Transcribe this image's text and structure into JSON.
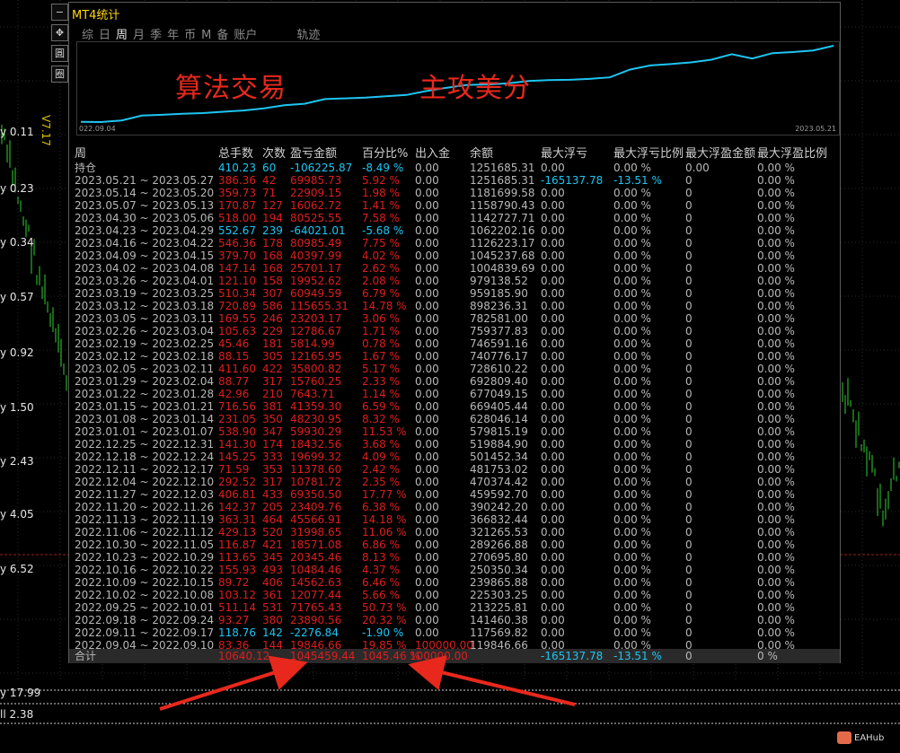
{
  "window": {
    "title": "MT4统计",
    "version_label": "V7.17"
  },
  "tool_buttons": [
    "✥",
    "圓",
    "圈"
  ],
  "tabs": [
    {
      "label": "综",
      "active": false
    },
    {
      "label": "日",
      "active": false
    },
    {
      "label": "周",
      "active": true
    },
    {
      "label": "月",
      "active": false
    },
    {
      "label": "季",
      "active": false
    },
    {
      "label": "年",
      "active": false
    },
    {
      "label": "币",
      "active": false
    },
    {
      "label": "M",
      "active": false
    },
    {
      "label": "备",
      "active": false
    },
    {
      "label": "账户",
      "active": false
    },
    {
      "label": "轨迹",
      "active": false,
      "gap": true
    }
  ],
  "equity_chart": {
    "start_label": "022.09.04",
    "end_label": "2023.05.21",
    "line_color": "#1ec5f2",
    "balance_points": [
      119846.66,
      117569.82,
      141460.38,
      213225.81,
      225303.25,
      239865.88,
      250350.34,
      270695.8,
      289266.88,
      321265.53,
      366832.44,
      390242.2,
      459592.7,
      470374.42,
      481753.02,
      501452.34,
      519884.9,
      579815.19,
      628046.14,
      669405.44,
      677049.15,
      692809.4,
      728610.22,
      740776.17,
      746591.16,
      759377.83,
      782581.0,
      898236.31,
      959185.9,
      979138.52,
      1004839.69,
      1045237.68,
      1126223.17,
      1062202.16,
      1142727.71,
      1158790.43,
      1181699.58,
      1251685.31
    ]
  },
  "overlay_texts": {
    "left": "算法交易",
    "right": "主攻美分"
  },
  "table": {
    "headers": [
      "周",
      "总手数",
      "次数",
      "盈亏金额",
      "百分比%",
      "出入金",
      "余额",
      "最大浮亏",
      "最大浮亏比例",
      "最大浮盈金额",
      "最大浮盈比例"
    ],
    "rows": [
      {
        "period": "持仓",
        "lots": "410.23",
        "count": "60",
        "pnl": "-106225.87",
        "pct": "-8.49 %",
        "io": "0.00",
        "balance": "1251685.31",
        "maxdd": "0.00",
        "maxdd_pct": "0.00 %",
        "maxfp": "0.00",
        "maxfp_pct": "0.00 %",
        "tone": "blue"
      },
      {
        "period": "2023.05.21 ~ 2023.05.27",
        "lots": "386.36",
        "count": "42",
        "pnl": "69985.73",
        "pct": "5.92 %",
        "io": "0.00",
        "balance": "1251685.31",
        "maxdd": "-165137.78",
        "maxdd_pct": "-13.51 %",
        "maxfp": "0",
        "maxfp_pct": "0.00 %",
        "tone": "red",
        "dd_tone": "blue"
      },
      {
        "period": "2023.05.14 ~ 2023.05.20",
        "lots": "359.73",
        "count": "71",
        "pnl": "22909.15",
        "pct": "1.98 %",
        "io": "0.00",
        "balance": "1181699.58",
        "maxdd": "0.00",
        "maxdd_pct": "0.00 %",
        "maxfp": "0",
        "maxfp_pct": "0.00 %",
        "tone": "red"
      },
      {
        "period": "2023.05.07 ~ 2023.05.13",
        "lots": "170.87",
        "count": "127",
        "pnl": "16062.72",
        "pct": "1.41 %",
        "io": "0.00",
        "balance": "1158790.43",
        "maxdd": "0.00",
        "maxdd_pct": "0.00 %",
        "maxfp": "0",
        "maxfp_pct": "0.00 %",
        "tone": "red"
      },
      {
        "period": "2023.04.30 ~ 2023.05.06",
        "lots": "518.00",
        "count": "194",
        "pnl": "80525.55",
        "pct": "7.58 %",
        "io": "0.00",
        "balance": "1142727.71",
        "maxdd": "0.00",
        "maxdd_pct": "0.00 %",
        "maxfp": "0",
        "maxfp_pct": "0.00 %",
        "tone": "red"
      },
      {
        "period": "2023.04.23 ~ 2023.04.29",
        "lots": "552.67",
        "count": "239",
        "pnl": "-64021.01",
        "pct": "-5.68 %",
        "io": "0.00",
        "balance": "1062202.16",
        "maxdd": "0.00",
        "maxdd_pct": "0.00 %",
        "maxfp": "0",
        "maxfp_pct": "0.00 %",
        "tone": "blue"
      },
      {
        "period": "2023.04.16 ~ 2023.04.22",
        "lots": "546.36",
        "count": "178",
        "pnl": "80985.49",
        "pct": "7.75 %",
        "io": "0.00",
        "balance": "1126223.17",
        "maxdd": "0.00",
        "maxdd_pct": "0.00 %",
        "maxfp": "0",
        "maxfp_pct": "0.00 %",
        "tone": "red"
      },
      {
        "period": "2023.04.09 ~ 2023.04.15",
        "lots": "379.70",
        "count": "168",
        "pnl": "40397.99",
        "pct": "4.02 %",
        "io": "0.00",
        "balance": "1045237.68",
        "maxdd": "0.00",
        "maxdd_pct": "0.00 %",
        "maxfp": "0",
        "maxfp_pct": "0.00 %",
        "tone": "red"
      },
      {
        "period": "2023.04.02 ~ 2023.04.08",
        "lots": "147.14",
        "count": "168",
        "pnl": "25701.17",
        "pct": "2.62 %",
        "io": "0.00",
        "balance": "1004839.69",
        "maxdd": "0.00",
        "maxdd_pct": "0.00 %",
        "maxfp": "0",
        "maxfp_pct": "0.00 %",
        "tone": "red"
      },
      {
        "period": "2023.03.26 ~ 2023.04.01",
        "lots": "121.10",
        "count": "158",
        "pnl": "19952.62",
        "pct": "2.08 %",
        "io": "0.00",
        "balance": "979138.52",
        "maxdd": "0.00",
        "maxdd_pct": "0.00 %",
        "maxfp": "0",
        "maxfp_pct": "0.00 %",
        "tone": "red"
      },
      {
        "period": "2023.03.19 ~ 2023.03.25",
        "lots": "510.34",
        "count": "307",
        "pnl": "60949.59",
        "pct": "6.79 %",
        "io": "0.00",
        "balance": "959185.90",
        "maxdd": "0.00",
        "maxdd_pct": "0.00 %",
        "maxfp": "0",
        "maxfp_pct": "0.00 %",
        "tone": "red"
      },
      {
        "period": "2023.03.12 ~ 2023.03.18",
        "lots": "720.89",
        "count": "586",
        "pnl": "115655.31",
        "pct": "14.78 %",
        "io": "0.00",
        "balance": "898236.31",
        "maxdd": "0.00",
        "maxdd_pct": "0.00 %",
        "maxfp": "0",
        "maxfp_pct": "0.00 %",
        "tone": "red"
      },
      {
        "period": "2023.03.05 ~ 2023.03.11",
        "lots": "169.55",
        "count": "246",
        "pnl": "23203.17",
        "pct": "3.06 %",
        "io": "0.00",
        "balance": "782581.00",
        "maxdd": "0.00",
        "maxdd_pct": "0.00 %",
        "maxfp": "0",
        "maxfp_pct": "0.00 %",
        "tone": "red"
      },
      {
        "period": "2023.02.26 ~ 2023.03.04",
        "lots": "105.63",
        "count": "229",
        "pnl": "12786.67",
        "pct": "1.71 %",
        "io": "0.00",
        "balance": "759377.83",
        "maxdd": "0.00",
        "maxdd_pct": "0.00 %",
        "maxfp": "0",
        "maxfp_pct": "0.00 %",
        "tone": "red"
      },
      {
        "period": "2023.02.19 ~ 2023.02.25",
        "lots": "45.46",
        "count": "181",
        "pnl": "5814.99",
        "pct": "0.78 %",
        "io": "0.00",
        "balance": "746591.16",
        "maxdd": "0.00",
        "maxdd_pct": "0.00 %",
        "maxfp": "0",
        "maxfp_pct": "0.00 %",
        "tone": "red"
      },
      {
        "period": "2023.02.12 ~ 2023.02.18",
        "lots": "88.15",
        "count": "305",
        "pnl": "12165.95",
        "pct": "1.67 %",
        "io": "0.00",
        "balance": "740776.17",
        "maxdd": "0.00",
        "maxdd_pct": "0.00 %",
        "maxfp": "0",
        "maxfp_pct": "0.00 %",
        "tone": "red"
      },
      {
        "period": "2023.02.05 ~ 2023.02.11",
        "lots": "411.60",
        "count": "422",
        "pnl": "35800.82",
        "pct": "5.17 %",
        "io": "0.00",
        "balance": "728610.22",
        "maxdd": "0.00",
        "maxdd_pct": "0.00 %",
        "maxfp": "0",
        "maxfp_pct": "0.00 %",
        "tone": "red"
      },
      {
        "period": "2023.01.29 ~ 2023.02.04",
        "lots": "88.77",
        "count": "317",
        "pnl": "15760.25",
        "pct": "2.33 %",
        "io": "0.00",
        "balance": "692809.40",
        "maxdd": "0.00",
        "maxdd_pct": "0.00 %",
        "maxfp": "0",
        "maxfp_pct": "0.00 %",
        "tone": "red"
      },
      {
        "period": "2023.01.22 ~ 2023.01.28",
        "lots": "42.96",
        "count": "210",
        "pnl": "7643.71",
        "pct": "1.14 %",
        "io": "0.00",
        "balance": "677049.15",
        "maxdd": "0.00",
        "maxdd_pct": "0.00 %",
        "maxfp": "0",
        "maxfp_pct": "0.00 %",
        "tone": "red"
      },
      {
        "period": "2023.01.15 ~ 2023.01.21",
        "lots": "716.56",
        "count": "381",
        "pnl": "41359.30",
        "pct": "6.59 %",
        "io": "0.00",
        "balance": "669405.44",
        "maxdd": "0.00",
        "maxdd_pct": "0.00 %",
        "maxfp": "0",
        "maxfp_pct": "0.00 %",
        "tone": "red"
      },
      {
        "period": "2023.01.08 ~ 2023.01.14",
        "lots": "231.05",
        "count": "350",
        "pnl": "48230.95",
        "pct": "8.32 %",
        "io": "0.00",
        "balance": "628046.14",
        "maxdd": "0.00",
        "maxdd_pct": "0.00 %",
        "maxfp": "0",
        "maxfp_pct": "0.00 %",
        "tone": "red"
      },
      {
        "period": "2023.01.01 ~ 2023.01.07",
        "lots": "538.90",
        "count": "347",
        "pnl": "59930.29",
        "pct": "11.53 %",
        "io": "0.00",
        "balance": "579815.19",
        "maxdd": "0.00",
        "maxdd_pct": "0.00 %",
        "maxfp": "0",
        "maxfp_pct": "0.00 %",
        "tone": "red"
      },
      {
        "period": "2022.12.25 ~ 2022.12.31",
        "lots": "141.30",
        "count": "174",
        "pnl": "18432.56",
        "pct": "3.68 %",
        "io": "0.00",
        "balance": "519884.90",
        "maxdd": "0.00",
        "maxdd_pct": "0.00 %",
        "maxfp": "0",
        "maxfp_pct": "0.00 %",
        "tone": "red"
      },
      {
        "period": "2022.12.18 ~ 2022.12.24",
        "lots": "145.25",
        "count": "333",
        "pnl": "19699.32",
        "pct": "4.09 %",
        "io": "0.00",
        "balance": "501452.34",
        "maxdd": "0.00",
        "maxdd_pct": "0.00 %",
        "maxfp": "0",
        "maxfp_pct": "0.00 %",
        "tone": "red"
      },
      {
        "period": "2022.12.11 ~ 2022.12.17",
        "lots": "71.59",
        "count": "353",
        "pnl": "11378.60",
        "pct": "2.42 %",
        "io": "0.00",
        "balance": "481753.02",
        "maxdd": "0.00",
        "maxdd_pct": "0.00 %",
        "maxfp": "0",
        "maxfp_pct": "0.00 %",
        "tone": "red"
      },
      {
        "period": "2022.12.04 ~ 2022.12.10",
        "lots": "292.52",
        "count": "317",
        "pnl": "10781.72",
        "pct": "2.35 %",
        "io": "0.00",
        "balance": "470374.42",
        "maxdd": "0.00",
        "maxdd_pct": "0.00 %",
        "maxfp": "0",
        "maxfp_pct": "0.00 %",
        "tone": "red"
      },
      {
        "period": "2022.11.27 ~ 2022.12.03",
        "lots": "406.81",
        "count": "433",
        "pnl": "69350.50",
        "pct": "17.77 %",
        "io": "0.00",
        "balance": "459592.70",
        "maxdd": "0.00",
        "maxdd_pct": "0.00 %",
        "maxfp": "0",
        "maxfp_pct": "0.00 %",
        "tone": "red"
      },
      {
        "period": "2022.11.20 ~ 2022.11.26",
        "lots": "142.37",
        "count": "205",
        "pnl": "23409.76",
        "pct": "6.38 %",
        "io": "0.00",
        "balance": "390242.20",
        "maxdd": "0.00",
        "maxdd_pct": "0.00 %",
        "maxfp": "0",
        "maxfp_pct": "0.00 %",
        "tone": "red"
      },
      {
        "period": "2022.11.13 ~ 2022.11.19",
        "lots": "363.31",
        "count": "464",
        "pnl": "45566.91",
        "pct": "14.18 %",
        "io": "0.00",
        "balance": "366832.44",
        "maxdd": "0.00",
        "maxdd_pct": "0.00 %",
        "maxfp": "0",
        "maxfp_pct": "0.00 %",
        "tone": "red"
      },
      {
        "period": "2022.11.06 ~ 2022.11.12",
        "lots": "429.13",
        "count": "520",
        "pnl": "31998.65",
        "pct": "11.06 %",
        "io": "0.00",
        "balance": "321265.53",
        "maxdd": "0.00",
        "maxdd_pct": "0.00 %",
        "maxfp": "0",
        "maxfp_pct": "0.00 %",
        "tone": "red"
      },
      {
        "period": "2022.10.30 ~ 2022.11.05",
        "lots": "116.87",
        "count": "421",
        "pnl": "18571.08",
        "pct": "6.86 %",
        "io": "0.00",
        "balance": "289266.88",
        "maxdd": "0.00",
        "maxdd_pct": "0.00 %",
        "maxfp": "0",
        "maxfp_pct": "0.00 %",
        "tone": "red"
      },
      {
        "period": "2022.10.23 ~ 2022.10.29",
        "lots": "113.65",
        "count": "345",
        "pnl": "20345.46",
        "pct": "8.13 %",
        "io": "0.00",
        "balance": "270695.80",
        "maxdd": "0.00",
        "maxdd_pct": "0.00 %",
        "maxfp": "0",
        "maxfp_pct": "0.00 %",
        "tone": "red"
      },
      {
        "period": "2022.10.16 ~ 2022.10.22",
        "lots": "155.93",
        "count": "493",
        "pnl": "10484.46",
        "pct": "4.37 %",
        "io": "0.00",
        "balance": "250350.34",
        "maxdd": "0.00",
        "maxdd_pct": "0.00 %",
        "maxfp": "0",
        "maxfp_pct": "0.00 %",
        "tone": "red"
      },
      {
        "period": "2022.10.09 ~ 2022.10.15",
        "lots": "89.72",
        "count": "406",
        "pnl": "14562.63",
        "pct": "6.46 %",
        "io": "0.00",
        "balance": "239865.88",
        "maxdd": "0.00",
        "maxdd_pct": "0.00 %",
        "maxfp": "0",
        "maxfp_pct": "0.00 %",
        "tone": "red"
      },
      {
        "period": "2022.10.02 ~ 2022.10.08",
        "lots": "103.12",
        "count": "361",
        "pnl": "12077.44",
        "pct": "5.66 %",
        "io": "0.00",
        "balance": "225303.25",
        "maxdd": "0.00",
        "maxdd_pct": "0.00 %",
        "maxfp": "0",
        "maxfp_pct": "0.00 %",
        "tone": "red"
      },
      {
        "period": "2022.09.25 ~ 2022.10.01",
        "lots": "511.14",
        "count": "531",
        "pnl": "71765.43",
        "pct": "50.73 %",
        "io": "0.00",
        "balance": "213225.81",
        "maxdd": "0.00",
        "maxdd_pct": "0.00 %",
        "maxfp": "0",
        "maxfp_pct": "0.00 %",
        "tone": "red"
      },
      {
        "period": "2022.09.18 ~ 2022.09.24",
        "lots": "93.27",
        "count": "380",
        "pnl": "23890.56",
        "pct": "20.32 %",
        "io": "0.00",
        "balance": "141460.38",
        "maxdd": "0.00",
        "maxdd_pct": "0.00 %",
        "maxfp": "0",
        "maxfp_pct": "0.00 %",
        "tone": "red"
      },
      {
        "period": "2022.09.11 ~ 2022.09.17",
        "lots": "118.76",
        "count": "142",
        "pnl": "-2276.84",
        "pct": "-1.90 %",
        "io": "0.00",
        "balance": "117569.82",
        "maxdd": "0.00",
        "maxdd_pct": "0.00 %",
        "maxfp": "0",
        "maxfp_pct": "0.00 %",
        "tone": "blue"
      },
      {
        "period": "2022.09.04 ~ 2022.09.10",
        "lots": "83.36",
        "count": "144",
        "pnl": "19846.66",
        "pct": "19.85 %",
        "io": "100000.00",
        "balance": "119846.66",
        "maxdd": "0.00",
        "maxdd_pct": "0.00 %",
        "maxfp": "0",
        "maxfp_pct": "0.00 %",
        "tone": "red",
        "io_tone": "red"
      }
    ],
    "total": {
      "period": "合计",
      "lots": "10640.12",
      "count": "",
      "pnl": "1045459.44",
      "pct": "1045.46 %",
      "io": "100000.00",
      "balance": "",
      "maxdd": "-165137.78",
      "maxdd_pct": "-13.51 %",
      "maxfp": "0",
      "maxfp_pct": "0 %"
    }
  },
  "price_axis_labels": [
    "y 0.11",
    "y 0.23",
    "y 0.34",
    "y 0.57",
    "y 0.92",
    "y 1.50",
    "y 2.43",
    "y 4.05",
    "y 6.52"
  ],
  "bottom_labels": [
    "y 17.99",
    "ll 2.38"
  ],
  "watermark": "EAHub"
}
